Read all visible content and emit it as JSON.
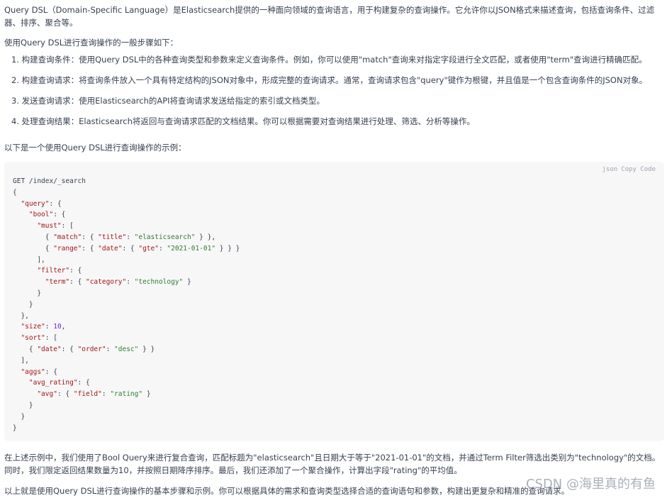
{
  "intro": "Query DSL（Domain-Specific Language）是Elasticsearch提供的一种面向领域的查询语言，用于构建复杂的查询操作。它允许你以JSON格式来描述查询，包括查询条件、过滤器、排序、聚合等。",
  "steps_intro": "使用Query DSL进行查询操作的一般步骤如下：",
  "steps": [
    "1. 构建查询条件：使用Query DSL中的各种查询类型和参数来定义查询条件。例如，你可以使用\"match\"查询来对指定字段进行全文匹配，或者使用\"term\"查询进行精确匹配。",
    "2. 构建查询请求：将查询条件放入一个具有特定结构的JSON对象中，形成完整的查询请求。通常，查询请求包含\"query\"键作为根键，并且值是一个包含查询条件的JSON对象。",
    "3. 发送查询请求：使用Elasticsearch的API将查询请求发送给指定的索引或文档类型。",
    "4. 处理查询结果：Elasticsearch将返回与查询请求匹配的文档结果。你可以根据需要对查询结果进行处理、筛选、分析等操作。"
  ],
  "example_intro": "以下是一个使用Query DSL进行查询操作的示例：",
  "code": {
    "language": "json",
    "copy_label": "Copy",
    "code_label": "Code",
    "request_line": "GET /index/_search",
    "tokens": {
      "query": "\"query\"",
      "bool": "\"bool\"",
      "must": "\"must\"",
      "match": "\"match\"",
      "title": "\"title\"",
      "elasticsearch": "\"elasticsearch\"",
      "range": "\"range\"",
      "date": "\"date\"",
      "gte": "\"gte\"",
      "date_val": "\"2021-01-01\"",
      "filter": "\"filter\"",
      "term": "\"term\"",
      "category": "\"category\"",
      "technology": "\"technology\"",
      "size": "\"size\"",
      "size_val": "10",
      "sort": "\"sort\"",
      "order": "\"order\"",
      "desc": "\"desc\"",
      "aggs": "\"aggs\"",
      "avg_rating": "\"avg_rating\"",
      "avg": "\"avg\"",
      "field": "\"field\"",
      "rating": "\"rating\""
    }
  },
  "summary": "在上述示例中，我们使用了Bool Query来进行复合查询，匹配标题为\"elasticsearch\"且日期大于等于\"2021-01-01\"的文档，并通过Term Filter筛选出类别为\"technology\"的文档。同时，我们限定返回结果数量为10，并按照日期降序排序。最后，我们还添加了一个聚合操作，计算出字段\"rating\"的平均值。",
  "conclusion": "以上就是使用Query DSL进行查询操作的基本步骤和示例。你可以根据具体的需求和查询类型选择合适的查询语句和参数，构建出更复杂和精准的查询请求。",
  "watermark": "CSDN @海里真的有鱼"
}
